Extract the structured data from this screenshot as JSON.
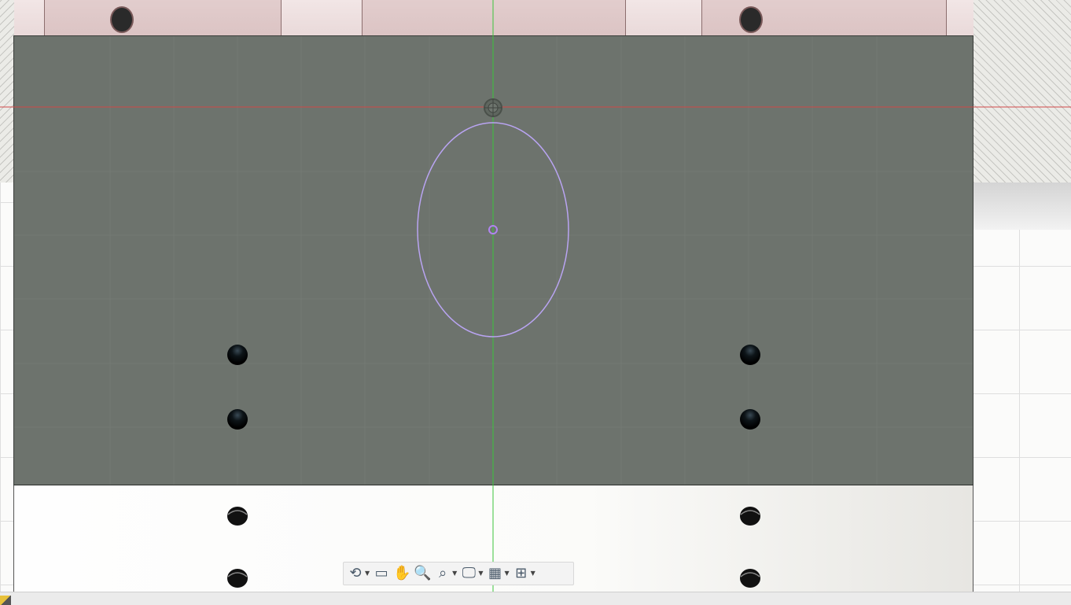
{
  "app": {
    "type": "3D CAD sketch viewport"
  },
  "colors": {
    "sketch_plane": "#6d736d",
    "x_axis": "#d04848",
    "y_axis": "#3cc43c",
    "sketch_profile": "#b9a4f2",
    "hole": "#0d1418"
  },
  "navigation_toolbar": {
    "tools": [
      {
        "name": "orbit-icon",
        "glyph": "⟲",
        "has_dropdown": true
      },
      {
        "name": "look-at-icon",
        "glyph": "▭",
        "has_dropdown": false
      },
      {
        "name": "pan-icon",
        "glyph": "✋",
        "has_dropdown": false
      },
      {
        "name": "zoom-icon",
        "glyph": "🔍",
        "has_dropdown": false
      },
      {
        "name": "fit-icon",
        "glyph": "⌕",
        "has_dropdown": true
      },
      {
        "name": "display-settings-icon",
        "glyph": "🖵",
        "has_dropdown": true
      },
      {
        "name": "grid-snaps-icon",
        "glyph": "▦",
        "has_dropdown": true
      },
      {
        "name": "viewports-icon",
        "glyph": "⊞",
        "has_dropdown": true
      }
    ]
  }
}
